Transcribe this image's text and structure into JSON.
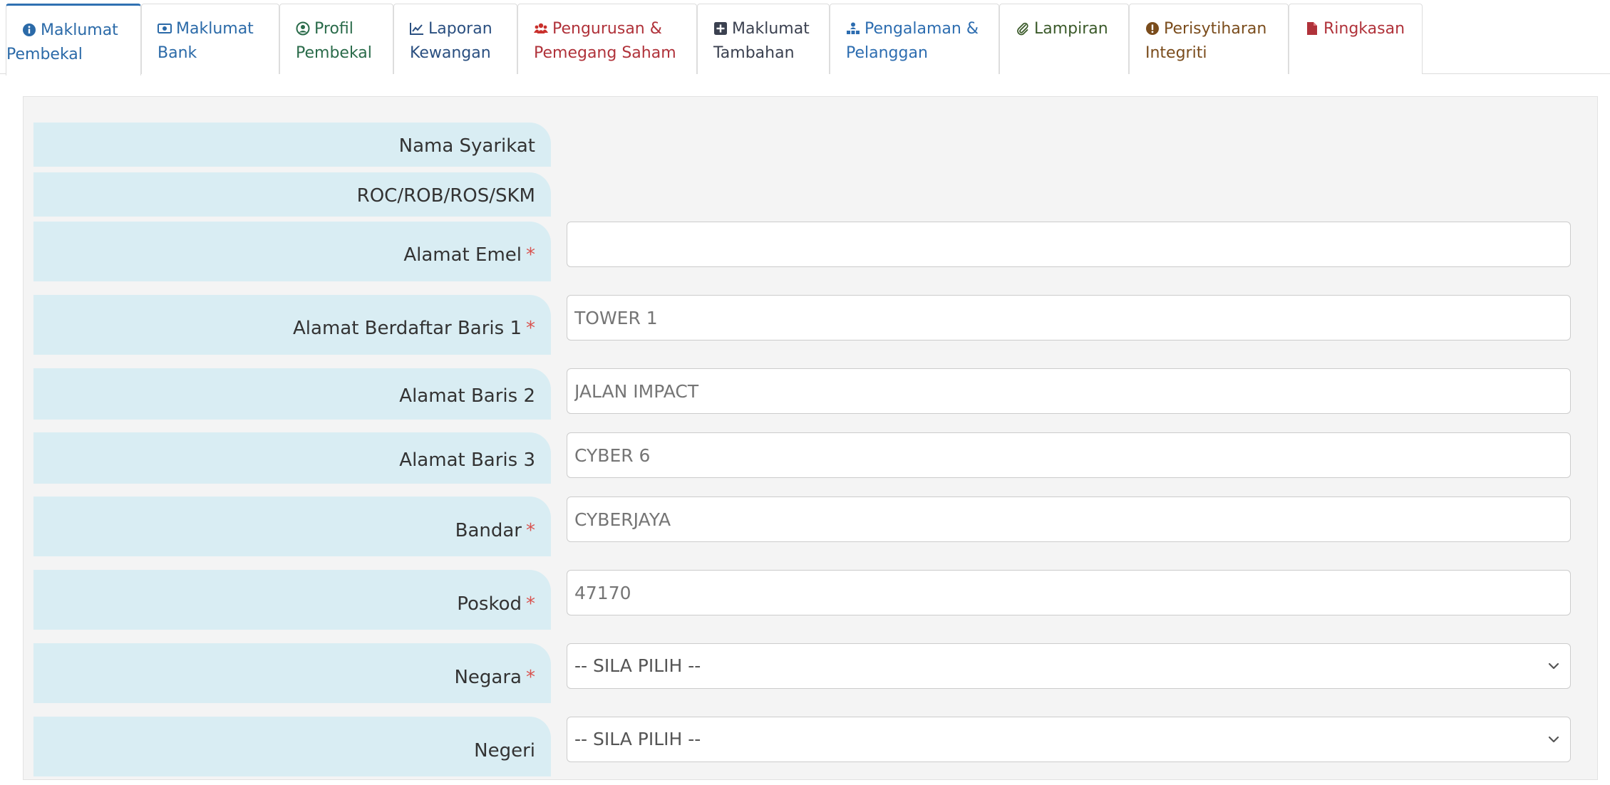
{
  "tabs": [
    {
      "line1": "Maklumat",
      "line2": "Pembekal",
      "icon": "info-circle-icon",
      "color": "#2b6aa8"
    },
    {
      "line1": "Maklumat",
      "line2": "Bank",
      "icon": "money-bill-icon",
      "color": "#2b6aa8"
    },
    {
      "line1": "Profil",
      "line2": "Pembekal",
      "icon": "user-circle-icon",
      "color": "#2a6b4a"
    },
    {
      "line1": "Laporan",
      "line2": "Kewangan",
      "icon": "line-chart-icon",
      "color": "#2a4f80"
    },
    {
      "line1": "Pengurusan &",
      "line2": "Pemegang Saham",
      "icon": "users-icon",
      "color": "#b0323a"
    },
    {
      "line1": "Maklumat",
      "line2": "Tambahan",
      "icon": "plus-square-icon",
      "color": "#3b4150"
    },
    {
      "line1": "Pengalaman &",
      "line2": "Pelanggan",
      "icon": "sitemap-icon",
      "color": "#2d6db0"
    },
    {
      "line1": "Lampiran",
      "line2": "",
      "icon": "paperclip-icon",
      "color": "#3b5a2a"
    },
    {
      "line1": "Perisytiharan",
      "line2": "Integriti",
      "icon": "exclamation-circle-icon",
      "color": "#7a4c1c"
    },
    {
      "line1": "Ringkasan",
      "line2": "",
      "icon": "file-icon",
      "color": "#b0323a"
    }
  ],
  "form": {
    "nama_syarikat": {
      "label": "Nama Syarikat"
    },
    "roc": {
      "label": "ROC/ROB/ROS/SKM"
    },
    "alamat_emel": {
      "label": "Alamat Emel",
      "required": "*",
      "value": ""
    },
    "alamat_baris1": {
      "label": "Alamat Berdaftar Baris 1",
      "required": "*",
      "placeholder": "TOWER 1"
    },
    "alamat_baris2": {
      "label": "Alamat Baris 2",
      "placeholder": "JALAN IMPACT"
    },
    "alamat_baris3": {
      "label": "Alamat Baris 3",
      "placeholder": "CYBER 6"
    },
    "bandar": {
      "label": "Bandar",
      "required": "*",
      "placeholder": "CYBERJAYA"
    },
    "poskod": {
      "label": "Poskod",
      "required": "*",
      "placeholder": "47170"
    },
    "negara": {
      "label": "Negara",
      "required": "*",
      "selected": "-- SILA PILIH --"
    },
    "negeri": {
      "label": "Negeri",
      "selected": "-- SILA PILIH --"
    }
  },
  "colors": {
    "label_bg": "#d9edf3",
    "panel_bg": "#f4f4f4",
    "required": "#d9534f",
    "active_tab_border": "#3071b2"
  }
}
